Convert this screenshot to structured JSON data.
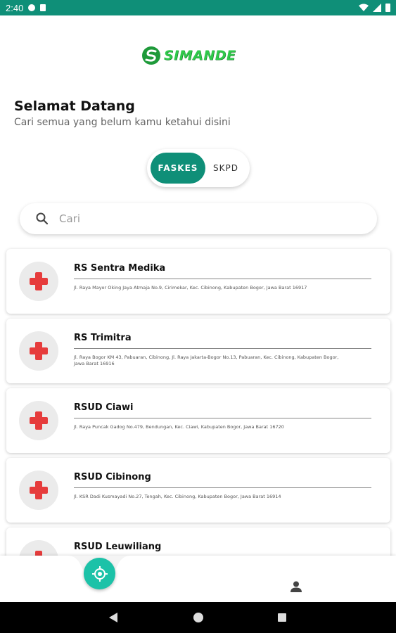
{
  "status_bar": {
    "time": "2:40"
  },
  "logo": {
    "text": "SIMANDE"
  },
  "welcome": {
    "title": "Selamat Datang",
    "subtitle": "Cari semua yang belum kamu ketahui disini"
  },
  "toggle": {
    "active": "FASKES",
    "inactive": "SKPD"
  },
  "search": {
    "placeholder": "Cari"
  },
  "facilities": [
    {
      "name": "RS Sentra Medika",
      "address": "Jl. Raya Mayor Oking Jaya Atmaja No.9, Cirimekar, Kec. Cibinong, Kabupaten Bogor, Jawa Barat 16917"
    },
    {
      "name": "RS Trimitra",
      "address": "Jl. Raya Bogor KM 43, Pabuaran, Cibinong, Jl. Raya Jakarta-Bogor No.13, Pabuaran, Kec. Cibinong, Kabupaten Bogor, Jawa Barat 16916"
    },
    {
      "name": "RSUD Ciawi",
      "address": "Jl. Raya Puncak Gadog No.479, Bendungan, Kec. Ciawi, Kabupaten Bogor, Jawa Barat 16720"
    },
    {
      "name": "RSUD Cibinong",
      "address": "Jl. KSR Dadi Kusmayadi No.27, Tengah, Kec. Cibinong, Kabupaten Bogor, Jawa Barat 16914"
    },
    {
      "name": "RSUD Leuwiliang",
      "address": ""
    }
  ],
  "colors": {
    "primary": "#0f8f78",
    "fab": "#1cc2a8",
    "cross": "#e63c3c",
    "logo": "#2fc94a"
  },
  "icons": {
    "fab": "target-icon",
    "profile": "person-icon",
    "search": "search-icon"
  }
}
